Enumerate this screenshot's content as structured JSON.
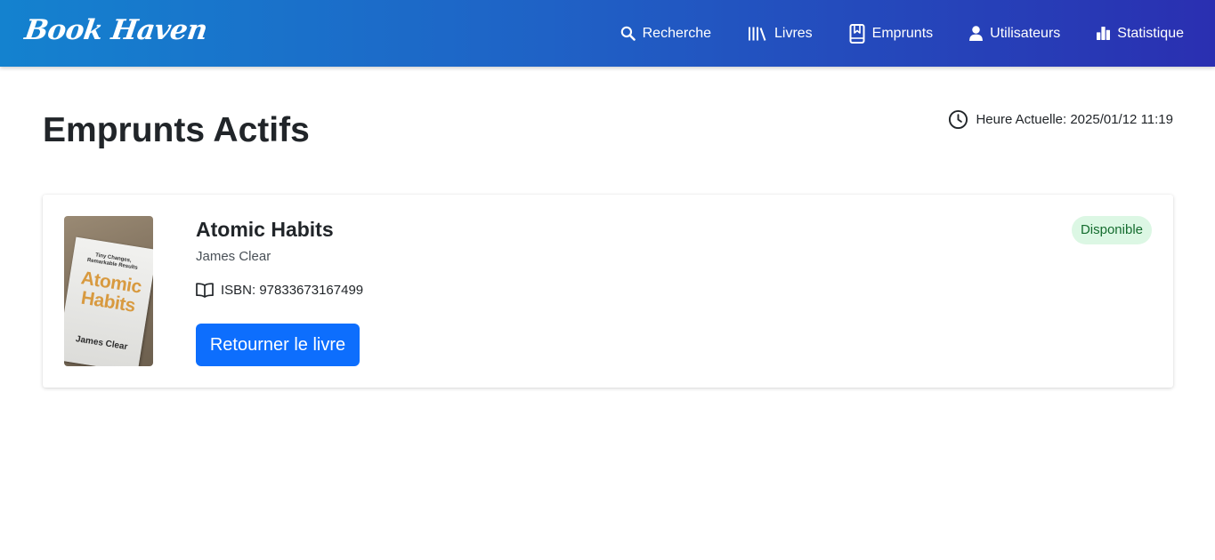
{
  "brand": "Book Haven",
  "nav": [
    {
      "label": "Recherche",
      "icon": "search-icon"
    },
    {
      "label": "Livres",
      "icon": "library-icon"
    },
    {
      "label": "Emprunts",
      "icon": "bookmark-book-icon"
    },
    {
      "label": "Utilisateurs",
      "icon": "user-icon"
    },
    {
      "label": "Statistique",
      "icon": "bar-chart-icon"
    }
  ],
  "page": {
    "title": "Emprunts Actifs",
    "clock_icon": "clock-icon",
    "current_time": "Heure Actuelle: 2025/01/12 11:19"
  },
  "loans": [
    {
      "title": "Atomic Habits",
      "author": "James Clear",
      "isbn": "ISBN: 97833673167499",
      "isbn_icon": "open-book-icon",
      "status": "Disponible",
      "action_label": "Retourner le livre",
      "cover": {
        "tagline": "Tiny Changes, Remarkable Results",
        "title_line1": "Atomic",
        "title_line2": "Habits",
        "author": "James Clear"
      }
    }
  ],
  "colors": {
    "nav_start": "#1482cf",
    "nav_end": "#2a2fb1",
    "primary_button": "#0d6efd",
    "badge_bg": "#dcf7e4",
    "badge_text": "#146c2e"
  }
}
